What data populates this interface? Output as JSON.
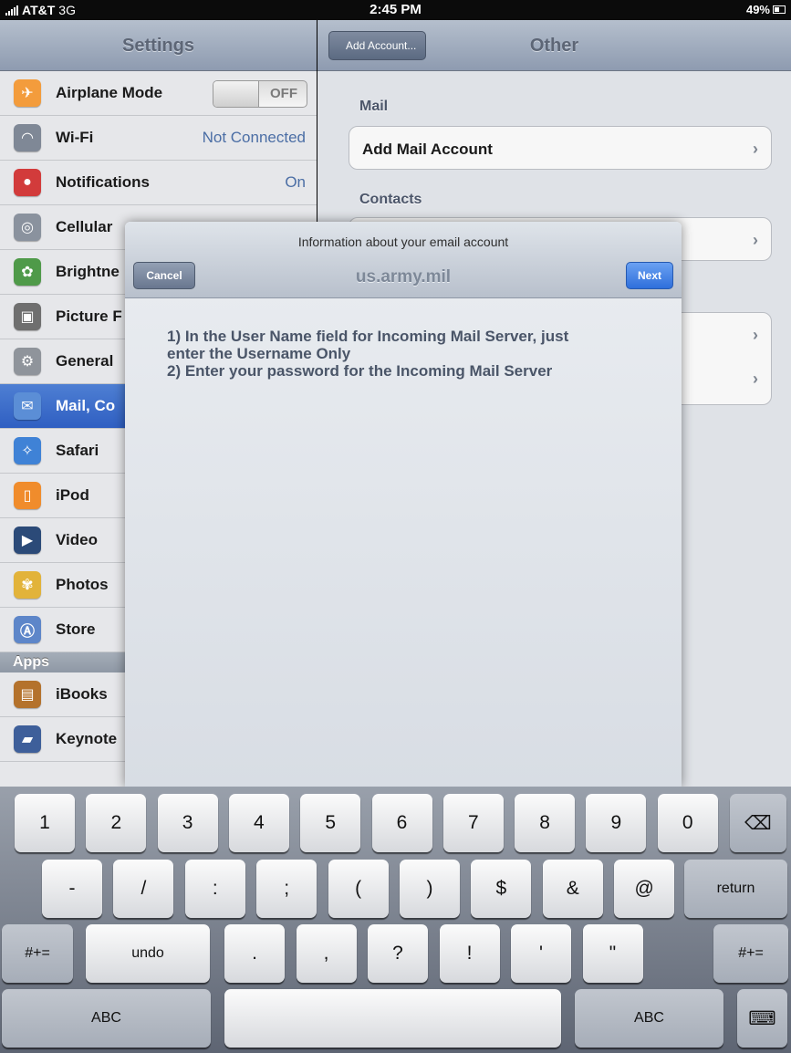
{
  "status_bar": {
    "carrier": "AT&T",
    "network": "3G",
    "time": "2:45 PM",
    "battery": "49%"
  },
  "settings": {
    "title": "Settings",
    "items": [
      {
        "label": "Airplane Mode",
        "toggle": "OFF",
        "icon": "airplane-icon",
        "color": "#f39c3c"
      },
      {
        "label": "Wi-Fi",
        "value": "Not Connected",
        "icon": "wifi-icon",
        "color": "#7f8896"
      },
      {
        "label": "Notifications",
        "value": "On",
        "icon": "notifications-icon",
        "color": "#d23b3b"
      },
      {
        "label": "Cellular",
        "icon": "cellular-icon",
        "color": "#8a929e"
      },
      {
        "label": "Brightne",
        "icon": "brightness-icon",
        "color": "#4f9a49"
      },
      {
        "label": "Picture F",
        "icon": "picture-frame-icon",
        "color": "#6f6f6f"
      },
      {
        "label": "General",
        "icon": "gear-icon",
        "color": "#8f949b"
      },
      {
        "label": "Mail, Co",
        "icon": "mail-icon",
        "color": "#5b8ed6",
        "selected": true
      },
      {
        "label": "Safari",
        "icon": "safari-icon",
        "color": "#3f82d6"
      },
      {
        "label": "iPod",
        "icon": "ipod-icon",
        "color": "#f08c2c"
      },
      {
        "label": "Video",
        "icon": "video-icon",
        "color": "#2b4a78"
      },
      {
        "label": "Photos",
        "icon": "photos-icon",
        "color": "#e2b33a"
      },
      {
        "label": "Store",
        "icon": "store-icon",
        "color": "#5d86c9"
      }
    ],
    "apps_header": "Apps",
    "apps": [
      {
        "label": "iBooks",
        "icon": "ibooks-icon",
        "color": "#b4722c"
      },
      {
        "label": "Keynote",
        "icon": "keynote-icon",
        "color": "#3e5f9a"
      }
    ]
  },
  "detail": {
    "back_label": "Add Account...",
    "title": "Other",
    "mail_header": "Mail",
    "add_mail_account": "Add Mail Account",
    "contacts_header": "Contacts"
  },
  "modal": {
    "prompt": "Information about your email account",
    "title": "us.army.mil",
    "cancel_label": "Cancel",
    "next_label": "Next",
    "instruction_lines": [
      "1) In the User Name field for Incoming Mail Server, just",
      "enter the Username Only",
      "2) Enter your password for the Incoming Mail Server"
    ]
  },
  "keyboard": {
    "row1": [
      "1",
      "2",
      "3",
      "4",
      "5",
      "6",
      "7",
      "8",
      "9",
      "0"
    ],
    "row2": [
      "-",
      "/",
      ":",
      ";",
      "(",
      ")",
      "$",
      "&",
      "@"
    ],
    "return_label": "return",
    "row3": [
      ".",
      ",",
      "?",
      "!",
      "'",
      "\""
    ],
    "symbols_label": "#+=",
    "undo_label": "undo",
    "abc_label": "ABC"
  }
}
